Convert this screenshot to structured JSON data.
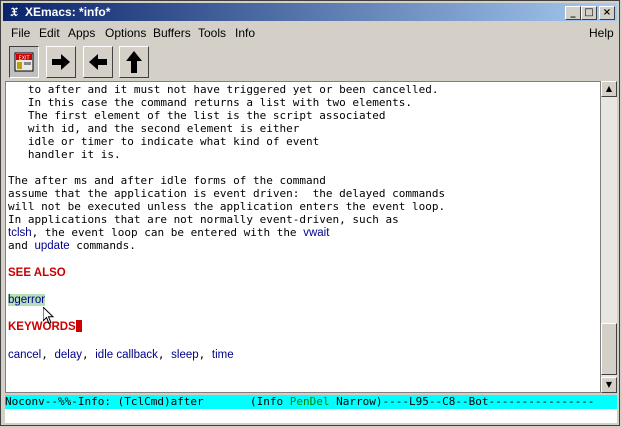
{
  "window": {
    "title": "XEmacs: *info*",
    "app_icon": "xemacs-icon"
  },
  "menubar": {
    "items": [
      "File",
      "Edit",
      "Apps",
      "Options",
      "Buffers",
      "Tools",
      "Info"
    ],
    "help": "Help"
  },
  "toolbar": {
    "buttons": [
      {
        "name": "exit-icon",
        "label": "EXIT"
      },
      {
        "name": "forward-arrow-icon"
      },
      {
        "name": "back-arrow-icon"
      },
      {
        "name": "up-arrow-icon"
      }
    ]
  },
  "content": {
    "lines": [
      "   to after and it must not have triggered yet or been cancelled.",
      "   In this case the command returns a list with two elements.",
      "   The first element of the list is the script associated",
      "   with id, and the second element is either",
      "   idle or timer to indicate what kind of event",
      "   handler it is.",
      "The after ms and after idle forms of the command",
      "assume that the application is event driven:  the delayed commands",
      "will not be executed unless the application enters the event loop.",
      "In applications that are not normally event-driven, such as"
    ],
    "tclsh_link": "tclsh",
    "tclsh_rest": ", the event loop can be entered with the ",
    "vwait_link": "vwait",
    "and_text": "and ",
    "update_link": "update",
    "commands_text": " commands.",
    "see_also": "SEE ALSO",
    "bgerror": "bgerror",
    "keywords": "KEYWORDS",
    "keyword_links": [
      "cancel",
      "delay",
      "idle callback",
      "sleep",
      "time"
    ],
    "sep": ", "
  },
  "modeline": {
    "left": "Noconv--%%-Info: (TclCmd)after       (Info ",
    "pendel": "PenDel",
    "right": " Narrow)----L95--C8--Bot----------------"
  },
  "colors": {
    "link": "#00008b",
    "header": "#cc0000",
    "modeline_bg": "#00ffff",
    "title_start": "#0a246a"
  }
}
